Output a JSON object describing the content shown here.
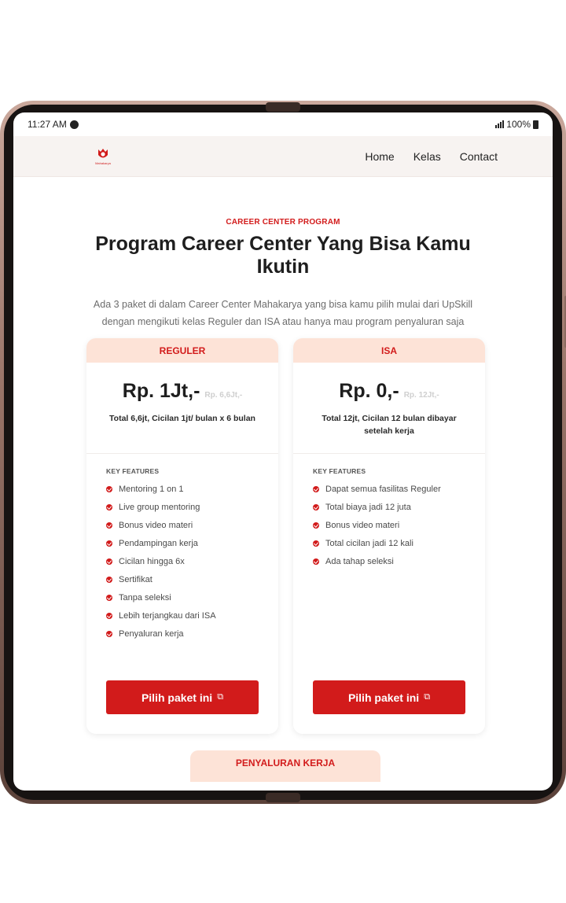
{
  "status": {
    "time": "11:27 AM",
    "battery": "100%"
  },
  "nav": {
    "logo_text": "Mahakarya",
    "links": [
      "Home",
      "Kelas",
      "Contact"
    ]
  },
  "hero": {
    "eyebrow": "CAREER CENTER PROGRAM",
    "title": "Program Career Center Yang Bisa Kamu Ikutin",
    "description": "Ada 3 paket di dalam Career Center Mahakarya yang bisa kamu pilih mulai dari UpSkill dengan mengikuti kelas Reguler dan ISA atau hanya mau program penyaluran saja"
  },
  "cards": [
    {
      "name": "REGULER",
      "price": "Rp. 1Jt,-",
      "old_price": "Rp. 6,6Jt,-",
      "note": "Total 6,6jt, Cicilan 1jt/ bulan x 6 bulan",
      "features_title": "KEY FEATURES",
      "features": [
        "Mentoring 1 on 1",
        "Live group mentoring",
        "Bonus video materi",
        "Pendampingan kerja",
        "Cicilan hingga 6x",
        "Sertifikat",
        "Tanpa seleksi",
        "Lebih terjangkau dari ISA",
        "Penyaluran kerja"
      ],
      "cta": "Pilih paket ini"
    },
    {
      "name": "ISA",
      "price": "Rp. 0,-",
      "old_price": "Rp. 12Jt,-",
      "note": "Total 12jt, Cicilan 12 bulan dibayar setelah kerja",
      "features_title": "KEY FEATURES",
      "features": [
        "Dapat semua fasilitas Reguler",
        "Total biaya jadi 12 juta",
        "Bonus video materi",
        "Total cicilan jadi 12 kali",
        "Ada tahap seleksi"
      ],
      "cta": "Pilih paket ini"
    }
  ],
  "next_section": {
    "label": "PENYALURAN KERJA"
  },
  "colors": {
    "accent": "#d21b1b",
    "card_header": "#fde3d7",
    "nav_bg": "#f7f3f1"
  },
  "icons": {
    "cta": "external-link-icon",
    "feature": "check-circle-icon"
  }
}
